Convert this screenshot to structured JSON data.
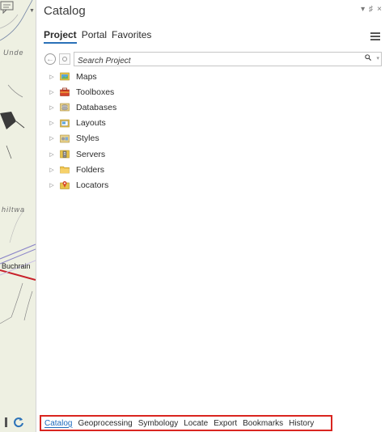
{
  "map": {
    "labels": [
      "Unde",
      "hiltwa",
      "Buchrain"
    ]
  },
  "pane": {
    "title": "Catalog",
    "controls": {
      "dropdown": "▾",
      "pin": "♯",
      "close": "×"
    }
  },
  "tabs": [
    {
      "label": "Project",
      "active": true
    },
    {
      "label": "Portal",
      "active": false
    },
    {
      "label": "Favorites",
      "active": false
    }
  ],
  "search": {
    "placeholder": "Search Project"
  },
  "tree": [
    {
      "label": "Maps",
      "icon": "maps-icon"
    },
    {
      "label": "Toolboxes",
      "icon": "toolboxes-icon"
    },
    {
      "label": "Databases",
      "icon": "databases-icon"
    },
    {
      "label": "Layouts",
      "icon": "layouts-icon"
    },
    {
      "label": "Styles",
      "icon": "styles-icon"
    },
    {
      "label": "Servers",
      "icon": "servers-icon"
    },
    {
      "label": "Folders",
      "icon": "folders-icon"
    },
    {
      "label": "Locators",
      "icon": "locators-icon"
    }
  ],
  "bottom_tabs": [
    {
      "label": "Catalog",
      "active": true
    },
    {
      "label": "Geoprocessing",
      "active": false
    },
    {
      "label": "Symbology",
      "active": false
    },
    {
      "label": "Locate",
      "active": false
    },
    {
      "label": "Export",
      "active": false
    },
    {
      "label": "Bookmarks",
      "active": false
    },
    {
      "label": "History",
      "active": false
    }
  ],
  "colors": {
    "accent": "#2a71b8",
    "highlight_border": "#d9251f",
    "map_bg": "#eef0e2"
  }
}
